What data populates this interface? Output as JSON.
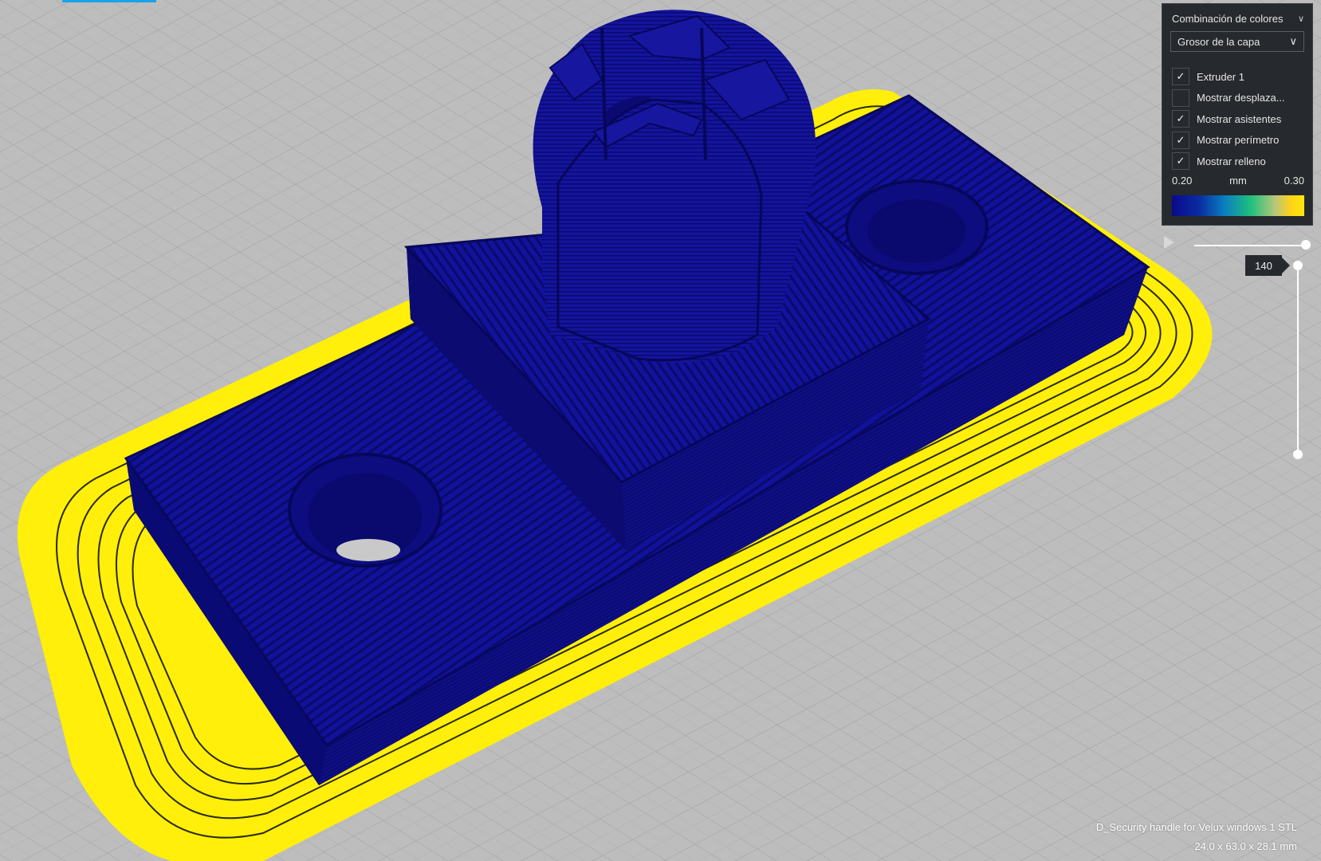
{
  "colors": {
    "build_plate": "#bdbdbd",
    "grid_line": "#a8a8a8",
    "model_blue": "#11119a",
    "model_dark": "#0a0a70",
    "brim_yellow": "#ffef0a",
    "panel_bg": "#26292d",
    "accent": "#1aa3e8"
  },
  "color_panel": {
    "scheme_label": "Combinación de colores",
    "scheme_value": "Grosor de la capa",
    "options": [
      {
        "label": "Extruder 1",
        "checked": true
      },
      {
        "label": "Mostrar desplaza...",
        "checked": false
      },
      {
        "label": "Mostrar asistentes",
        "checked": true
      },
      {
        "label": "Mostrar perímetro",
        "checked": true
      },
      {
        "label": "Mostrar relleno",
        "checked": true
      }
    ],
    "legend": {
      "min": "0.20",
      "unit": "mm",
      "max": "0.30"
    }
  },
  "layer_slider": {
    "current_layer": "140"
  },
  "file_info": {
    "name": "D_Security handle for Velux windows 1 STL",
    "dimensions": "24.0 x 63.0 x 28.1 mm"
  },
  "icons": {
    "chevron": "chevron-down-icon",
    "check": "check-icon",
    "play": "play-icon"
  }
}
